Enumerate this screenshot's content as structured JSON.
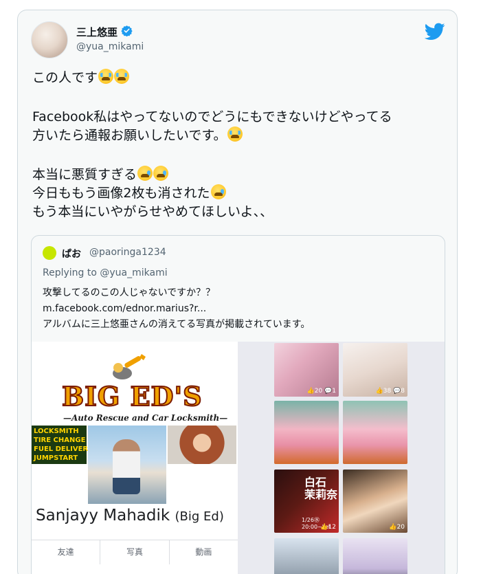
{
  "tweet": {
    "display_name": "三上悠亜",
    "handle": "@yua_mikami",
    "lines": [
      "この人です",
      "Facebook私はやってないのでどうにもできないけどやってる",
      "方いたら通報お願いしたいです。",
      "本当に悪質すぎる",
      "今日ももう画像2枚も消された",
      "もう本当にいやがらせやめてほしいよ、、"
    ]
  },
  "quote": {
    "name": "ぱお",
    "handle": "@paoringa1234",
    "replying_label": "Replying to",
    "replying_mention": "@yua_mikami",
    "lines": [
      "攻撃してるのこの人じゃないですか？？",
      "m.facebook.com/ednor.marius?r...",
      "アルバムに三上悠亜さんの消えてる写真が掲載されています。"
    ]
  },
  "facebook": {
    "logo_text": "BIG ED'S",
    "logo_sub": "—Auto Rescue and Car Locksmith—",
    "services": [
      "LOCKSMITH",
      "TIRE CHANGE",
      "FUEL DELIVER",
      "JUMPSTART"
    ],
    "profile_name": "Sanjayy Mahadik",
    "profile_alias": "(Big Ed)",
    "tabs": [
      "友達",
      "写真",
      "動画"
    ]
  },
  "thumbs": [
    {
      "stats": "👍20 💬1"
    },
    {
      "stats": "👍38 💬8"
    },
    {
      "stats": ""
    },
    {
      "stats": ""
    },
    {
      "title": "白石 茉莉奈",
      "date": "1/26㊌ 20:00~Let",
      "stats": "👍12"
    },
    {
      "stats": "👍20"
    },
    {
      "stats": ""
    },
    {
      "stats": ""
    }
  ],
  "colors": {
    "twitter_blue": "#1d9bf0",
    "verified": "#1d9bf0",
    "quote_avatar": "#c6e600"
  }
}
